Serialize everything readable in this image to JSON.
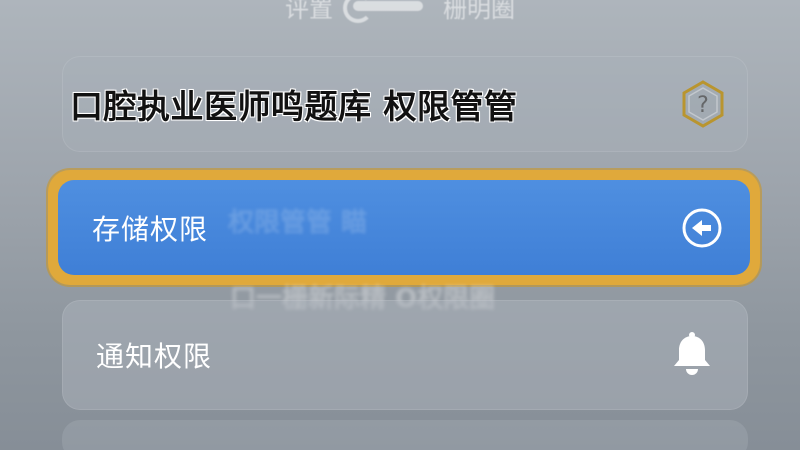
{
  "top_ghost": {
    "left_text": "评置",
    "right_text": "栅明圈"
  },
  "title_card": {
    "title": "口腔执业医师鸣题库 权限管管",
    "help_icon": "help-hexagon-icon"
  },
  "storage_row": {
    "label": "存储权限",
    "ghost_text": "权限管管 瞄",
    "action_icon": "back-arrow-circle-icon"
  },
  "ghost_under_text": "口一栅新际精 O权限圈",
  "notify_row": {
    "label": "通知权限",
    "action_icon": "bell-icon"
  },
  "colors": {
    "accent_blue": "#3f7fd6",
    "highlight_border": "#e0a93b",
    "help_border": "#b9952f"
  }
}
